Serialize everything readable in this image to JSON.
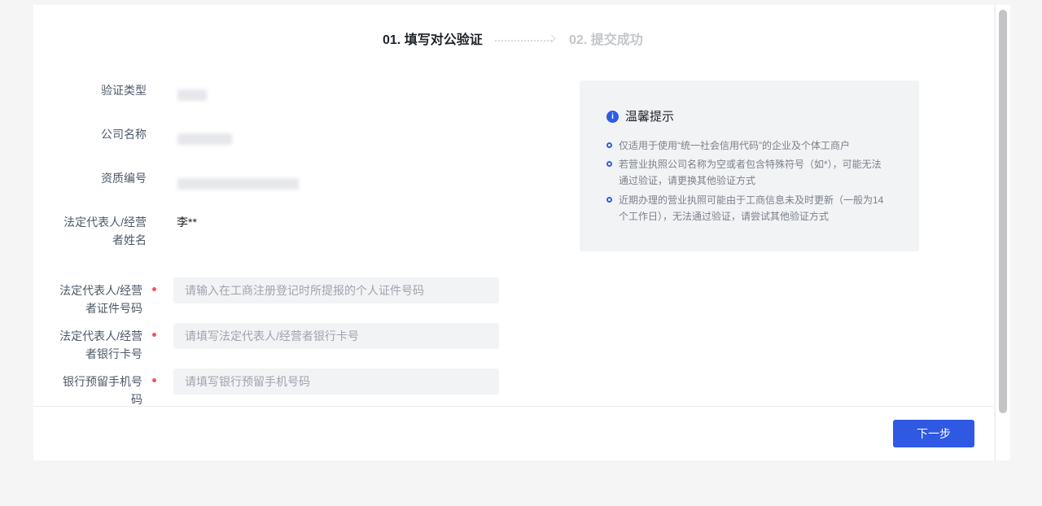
{
  "steps": [
    {
      "label": "01. 填写对公验证",
      "state": "active"
    },
    {
      "label": "02. 提交成功",
      "state": "pending"
    }
  ],
  "form": {
    "verify_type": {
      "label": "验证类型",
      "value_redacted": true
    },
    "company_name": {
      "label": "公司名称",
      "value_redacted": true
    },
    "license_no": {
      "label": "资质编号",
      "value_redacted": true
    },
    "legal_rep_name": {
      "label_line1": "法定代表人/经营",
      "label_line2": "者姓名",
      "value": "李**"
    },
    "id_number": {
      "label_line1": "法定代表人/经营",
      "label_line2": "者证件号码",
      "required": true,
      "value": "",
      "placeholder": "请输入在工商注册登记时所提报的个人证件号码"
    },
    "bank_card": {
      "label_line1": "法定代表人/经营",
      "label_line2": "者银行卡号",
      "required": true,
      "value": "",
      "placeholder": "请填写法定代表人/经营者银行卡号"
    },
    "bank_phone": {
      "label_line1": "银行预留手机号",
      "label_line2": "码",
      "required": true,
      "value": "",
      "placeholder": "请填写银行预留手机号码"
    }
  },
  "tips": {
    "icon": "info-icon",
    "title": "温馨提示",
    "items": [
      {
        "line1": "仅适用于使用“统一社会信用代码”的企业及个体工商户"
      },
      {
        "line1": "若营业执照公司名称为空或者包含特殊符号（如*），可能无法",
        "line2": "通过验证，请更换其他验证方式"
      },
      {
        "line1": "近期办理的营业执照可能由于工商信息未及时更新（一般为14",
        "line2": "个工作日），无法通过验证，请尝试其他验证方式"
      }
    ]
  },
  "actions": {
    "next_label": "下一步"
  },
  "colors": {
    "primary": "#2f59e3",
    "required": "#f5545d",
    "panel_bg": "#f2f3f5"
  }
}
